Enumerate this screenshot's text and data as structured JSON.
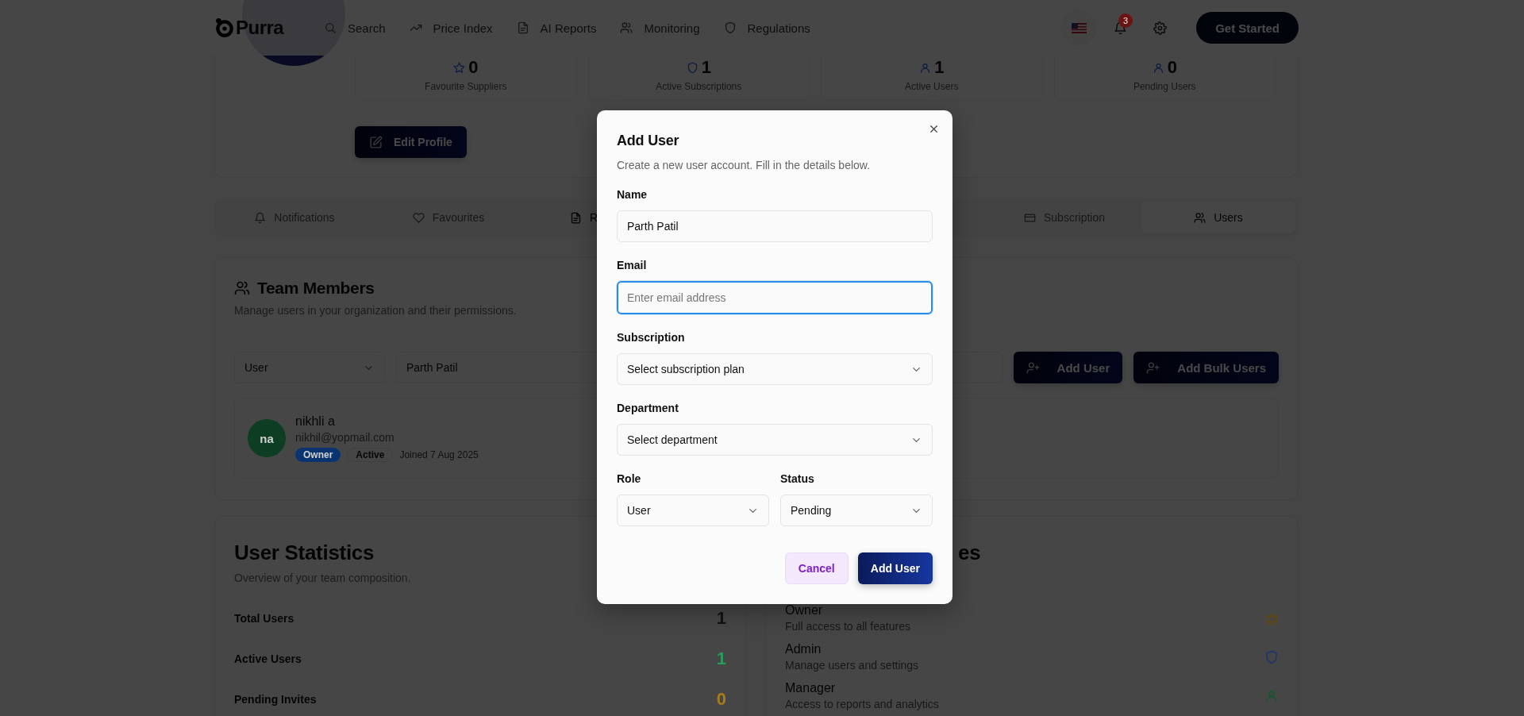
{
  "nav": {
    "logo": "Purra",
    "items": [
      {
        "label": "Search"
      },
      {
        "label": "Price Index"
      },
      {
        "label": "AI Reports"
      },
      {
        "label": "Monitoring"
      },
      {
        "label": "Regulations"
      }
    ],
    "notification_count": "3",
    "cta": "Get Started"
  },
  "profile": {
    "stats": [
      {
        "value": "0",
        "label": "Favourite Suppliers"
      },
      {
        "value": "1",
        "label": "Active Subscriptions"
      },
      {
        "value": "1",
        "label": "Active Users"
      },
      {
        "value": "0",
        "label": "Pending Users"
      }
    ],
    "edit_button": "Edit Profile"
  },
  "tabs": [
    {
      "label": "Notifications",
      "selected": false
    },
    {
      "label": "Favourites",
      "selected": false
    },
    {
      "label": "R",
      "selected": false
    },
    {
      "label": "Subscription",
      "selected": false
    },
    {
      "label": "Users",
      "selected": true
    }
  ],
  "team": {
    "title": "Team Members",
    "description": "Manage users in your organization and their permissions.",
    "role_filter": "User",
    "name_field": "Parth Patil",
    "add_button": "Add User",
    "bulk_button": "Add Bulk Users",
    "members": [
      {
        "initials": "na",
        "name": "nikhli a",
        "email": "nikhil@yopmail.com",
        "role": "Owner",
        "status": "Active",
        "joined": "Joined 7 Aug 2025"
      }
    ]
  },
  "user_statistics": {
    "title": "User Statistics",
    "description": "Overview of your team composition.",
    "rows": [
      {
        "label": "Total Users",
        "value": "1",
        "color": "#111111"
      },
      {
        "label": "Active Users",
        "value": "1",
        "color": "#2a9a58"
      },
      {
        "label": "Pending Invites",
        "value": "0",
        "color": "#a87c18"
      }
    ]
  },
  "roles_card": {
    "title": "es",
    "roles": [
      {
        "name": "Owner",
        "description": "Full access to all features",
        "color": "#5c4810"
      },
      {
        "name": "Admin",
        "description": "Manage users and settings",
        "color": "#1c3470"
      },
      {
        "name": "Manager",
        "description": "Access to reports and analytics",
        "color": "#14562e"
      }
    ]
  },
  "dialog": {
    "title": "Add User",
    "description": "Create a new user account. Fill in the details below.",
    "fields": [
      {
        "kind": "input",
        "label": "Name",
        "value": "Parth Patil",
        "focused": false
      },
      {
        "kind": "input",
        "label": "Email",
        "placeholder": "Enter email address",
        "focused": true
      },
      {
        "kind": "select",
        "label": "Subscription",
        "value": "Select subscription plan",
        "focused": false
      },
      {
        "kind": "select",
        "label": "Department",
        "value": "Select department",
        "focused": false
      }
    ],
    "paired_fields": [
      {
        "kind": "select",
        "label": "Role",
        "value": "User",
        "focused": false
      },
      {
        "kind": "select",
        "label": "Status",
        "value": "Pending",
        "focused": false
      }
    ],
    "cancel": "Cancel",
    "submit": "Add User"
  }
}
